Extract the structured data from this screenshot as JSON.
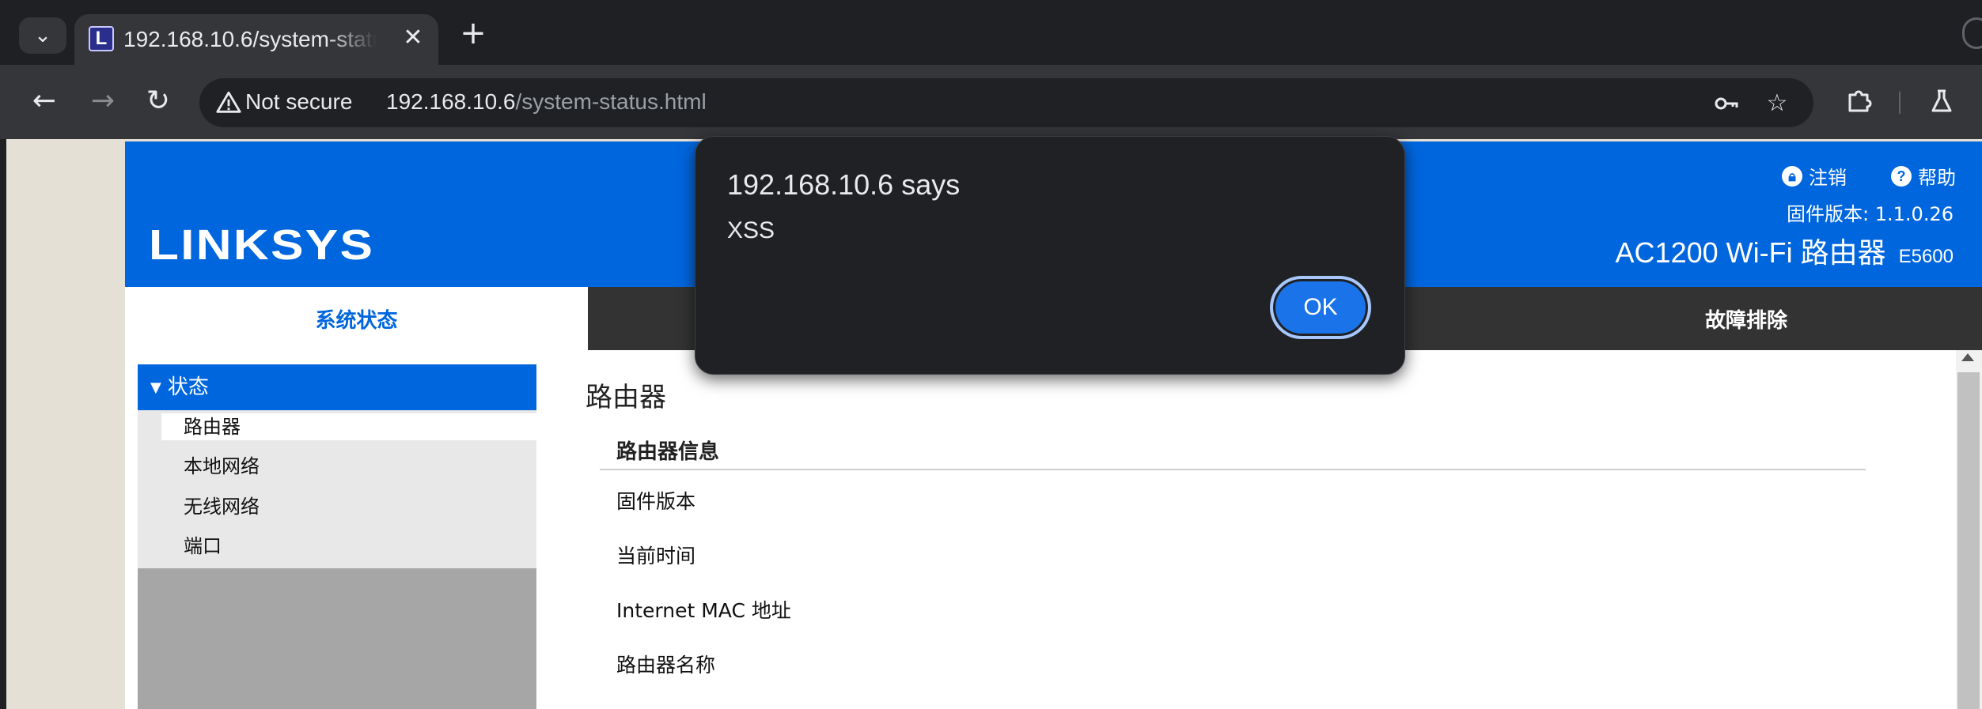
{
  "browser": {
    "tab_title": "192.168.10.6/system-status.html",
    "tab_favicon_letter": "L",
    "omnibox": {
      "security_label": "Not secure",
      "url_host": "192.168.10.6",
      "url_path": "/system-status.html"
    }
  },
  "router_page": {
    "header": {
      "logo": "LINKSYS",
      "logout": "注销",
      "help": "帮助",
      "firmware_version": "固件版本: 1.1.0.26",
      "model_name": "AC1200 Wi-Fi 路由器",
      "model_code": "E5600"
    },
    "tabs": {
      "active": "系统状态",
      "right": "故障排除"
    },
    "sidebar": {
      "section": "状态",
      "items": [
        {
          "label": "路由器"
        },
        {
          "label": "本地网络"
        },
        {
          "label": "无线网络"
        },
        {
          "label": "端口"
        }
      ]
    },
    "content": {
      "title": "路由器",
      "section_title": "路由器信息",
      "rows": [
        {
          "label": "固件版本"
        },
        {
          "label": "当前时间"
        },
        {
          "label": "Internet MAC 地址"
        },
        {
          "label": "路由器名称"
        }
      ]
    }
  },
  "alert": {
    "title": "192.168.10.6 says",
    "message": "XSS",
    "ok_label": "OK"
  },
  "colors": {
    "linksys_blue": "#0066de",
    "dialog_bg": "#202124",
    "ok_button": "#1a73e8"
  }
}
